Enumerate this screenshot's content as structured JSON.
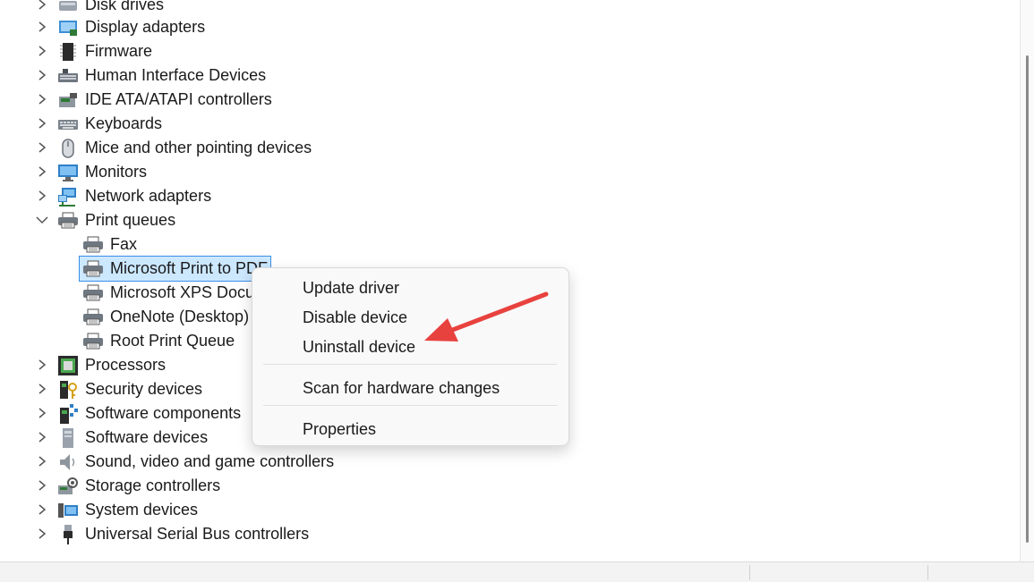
{
  "tree": {
    "categories": [
      {
        "label": "Disk drives",
        "icon": "disk-drive-icon"
      },
      {
        "label": "Display adapters",
        "icon": "display-adapter-icon"
      },
      {
        "label": "Firmware",
        "icon": "firmware-chip-icon"
      },
      {
        "label": "Human Interface Devices",
        "icon": "hid-keyboard-icon"
      },
      {
        "label": "IDE ATA/ATAPI controllers",
        "icon": "ide-controller-icon"
      },
      {
        "label": "Keyboards",
        "icon": "keyboard-icon"
      },
      {
        "label": "Mice and other pointing devices",
        "icon": "mouse-icon"
      },
      {
        "label": "Monitors",
        "icon": "monitor-icon"
      },
      {
        "label": "Network adapters",
        "icon": "network-adapter-icon"
      },
      {
        "label": "Print queues",
        "icon": "printer-icon",
        "expanded": true
      },
      {
        "label": "Processors",
        "icon": "processor-icon"
      },
      {
        "label": "Security devices",
        "icon": "security-device-icon"
      },
      {
        "label": "Software components",
        "icon": "software-component-icon"
      },
      {
        "label": "Software devices",
        "icon": "software-device-icon"
      },
      {
        "label": "Sound, video and game controllers",
        "icon": "speaker-icon"
      },
      {
        "label": "Storage controllers",
        "icon": "storage-controller-icon"
      },
      {
        "label": "System devices",
        "icon": "system-device-icon"
      },
      {
        "label": "Universal Serial Bus controllers",
        "icon": "usb-icon"
      }
    ],
    "print_queue_children": [
      {
        "label": "Fax",
        "icon": "printer-icon"
      },
      {
        "label": "Microsoft Print to PDF",
        "icon": "printer-icon",
        "selected": true
      },
      {
        "label": "Microsoft XPS Document Writer",
        "icon": "printer-icon"
      },
      {
        "label": "OneNote (Desktop)",
        "icon": "printer-icon"
      },
      {
        "label": "Root Print Queue",
        "icon": "printer-icon"
      }
    ]
  },
  "context_menu": {
    "items": [
      {
        "label": "Update driver"
      },
      {
        "label": "Disable device"
      },
      {
        "label": "Uninstall device",
        "highlighted_by_arrow": true
      },
      {
        "label": "Scan for hardware changes"
      },
      {
        "label": "Properties"
      }
    ]
  },
  "colors": {
    "selection_bg": "#cce8ff",
    "selection_border": "#3a8ee6",
    "annotation_arrow": "#e8423f"
  }
}
